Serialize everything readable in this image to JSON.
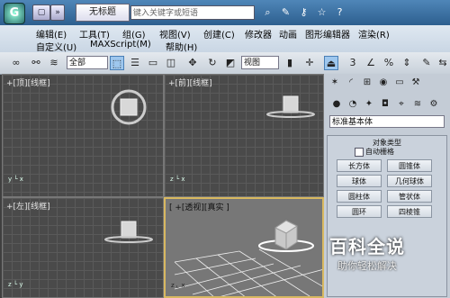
{
  "titlebar": {
    "app_logo": "G",
    "quick_access": [
      "▢",
      "»"
    ],
    "doc_title": "无标题",
    "search_placeholder": "键入关键字或短语",
    "tools": [
      "search-binoculars",
      "wrench",
      "key",
      "star",
      "help"
    ]
  },
  "menu": {
    "row1": [
      "编辑(E)",
      "工具(T)",
      "组(G)",
      "视图(V)",
      "创建(C)",
      "修改器",
      "动画",
      "图形编辑器",
      "渲染(R)"
    ],
    "row2": [
      "自定义(U)",
      "MAXScript(M)",
      "帮助(H)"
    ]
  },
  "toolbar": {
    "filter_value": "全部",
    "coord_value": "视图",
    "snap_value": "3"
  },
  "viewports": {
    "top": "+[顶][线框]",
    "front": "+[前][线框]",
    "left": "+[左][线框]",
    "perspective": "[ +[透视][真实 ]"
  },
  "command_panel": {
    "category_value": "标准基本体",
    "rollout_title": "对象类型",
    "autogrid_label": "自动栅格",
    "buttons": [
      "长方体",
      "圆锥体",
      "球体",
      "几何球体",
      "圆柱体",
      "管状体",
      "圆环",
      "四棱锥"
    ]
  },
  "watermark": {
    "title": "百科全说",
    "subtitle": "助你轻松解决"
  }
}
